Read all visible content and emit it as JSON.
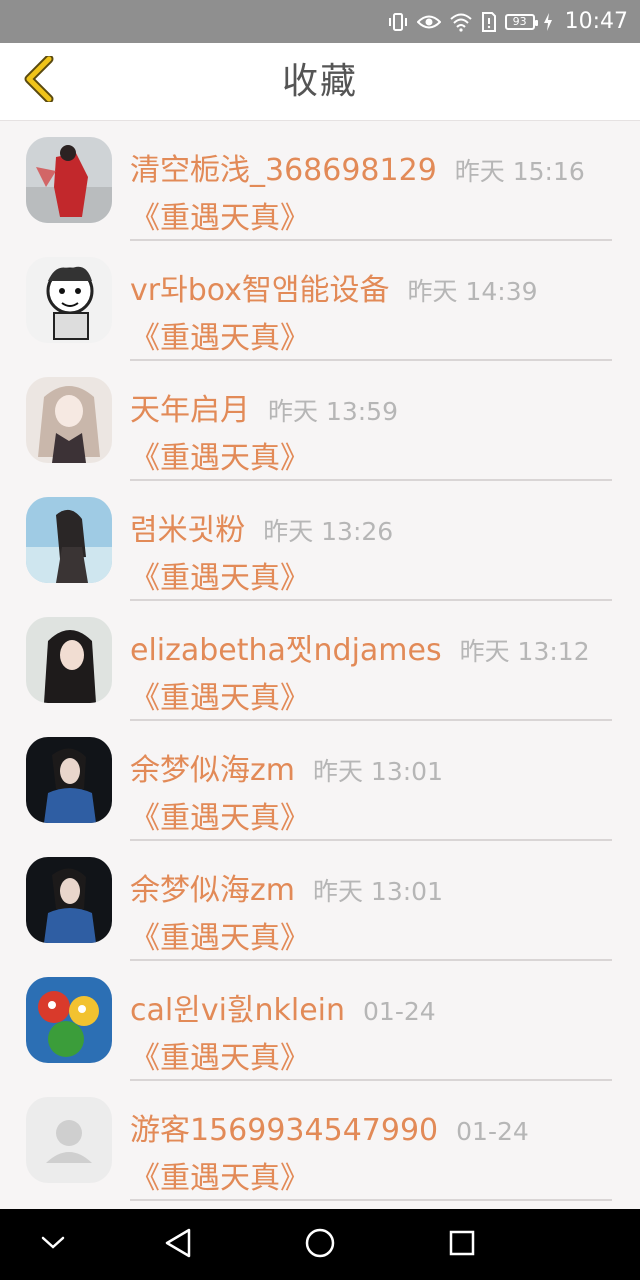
{
  "status_bar": {
    "battery": "93",
    "time": "10:47",
    "icons": [
      "vibrate-icon",
      "eye-icon",
      "wifi-icon",
      "sim-alert-icon",
      "battery-icon",
      "charging-icon"
    ]
  },
  "header": {
    "title": "收藏",
    "back_icon": "chevron-left-icon"
  },
  "colors": {
    "accent": "#e28a57",
    "back_arrow": "#f0c419",
    "time_text": "#b6b6b6",
    "background": "#f7f5f5"
  },
  "favorites": [
    {
      "name": "清空栀浅_368698129",
      "time": "昨天 15:16",
      "book": "《重遇天真》",
      "avatar": "red-figure-avatar"
    },
    {
      "name": "vr돠box智앰能设备",
      "time": "昨天 14:39",
      "book": "《重遇天真》",
      "avatar": "cartoon-sketch-avatar"
    },
    {
      "name": "天年启月",
      "time": "昨天 13:59",
      "book": "《重遇天真》",
      "avatar": "anime-girl-avatar"
    },
    {
      "name": "렴米굇粉",
      "time": "昨天 13:26",
      "book": "《重遇天真》",
      "avatar": "beach-girl-avatar"
    },
    {
      "name": "elizabetha찟ndjames",
      "time": "昨天 13:12",
      "book": "《重遇天真》",
      "avatar": "dark-hair-girl-avatar"
    },
    {
      "name": "余梦似海zm",
      "time": "昨天 13:01",
      "book": "《重遇天真》",
      "avatar": "girl-blue-shirt-avatar"
    },
    {
      "name": "余梦似海zm",
      "time": "昨天 13:01",
      "book": "《重遇天真》",
      "avatar": "girl-blue-shirt-avatar"
    },
    {
      "name": "cal윈vi흸nklein",
      "time": "01-24",
      "book": "《重遇天真》",
      "avatar": "cartoon-characters-avatar"
    },
    {
      "name": "游客1569934547990",
      "time": "01-24",
      "book": "《重遇天真》",
      "avatar": "default-user-avatar"
    }
  ],
  "nav_bar": {
    "buttons": [
      "chevron-down-icon",
      "back-triangle-icon",
      "home-circle-icon",
      "recents-square-icon"
    ]
  }
}
